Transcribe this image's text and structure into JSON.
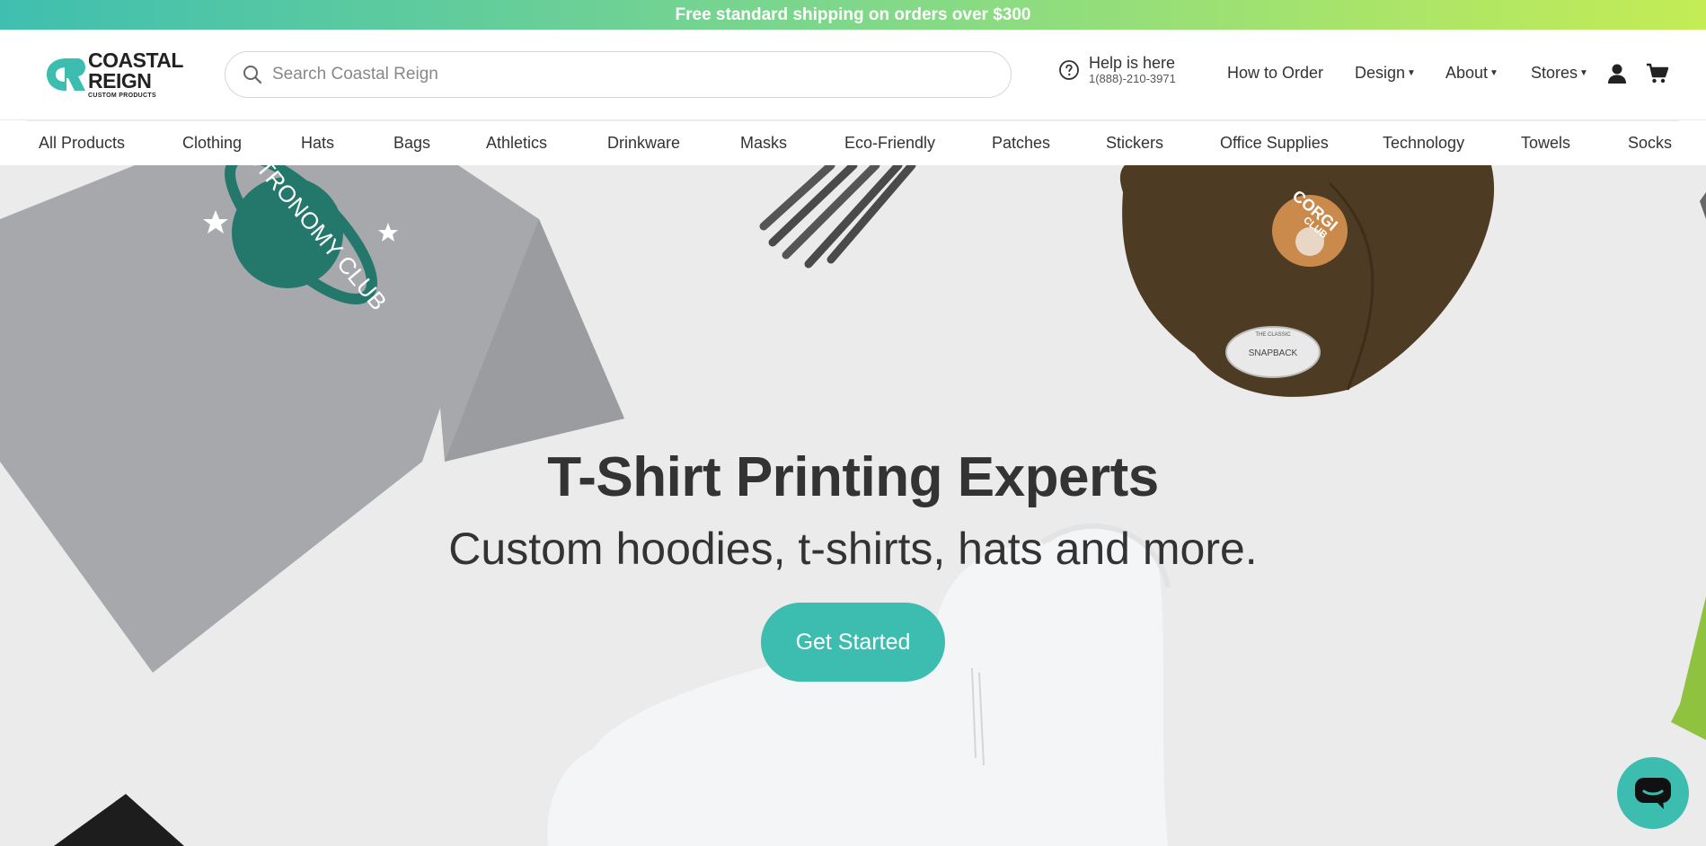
{
  "promo": {
    "text": "Free standard shipping on orders over $300"
  },
  "brand": {
    "line1": "COASTAL",
    "line2": "REIGN",
    "line3": "CUSTOM PRODUCTS"
  },
  "search": {
    "placeholder": "Search Coastal Reign",
    "value": ""
  },
  "help": {
    "title": "Help is here",
    "phone": "1(888)-210-3971"
  },
  "topnav": {
    "how_to_order": "How to Order",
    "design": "Design",
    "about": "About",
    "stores": "Stores"
  },
  "categories": [
    "All Products",
    "Clothing",
    "Hats",
    "Bags",
    "Athletics",
    "Drinkware",
    "Masks",
    "Eco-Friendly",
    "Patches",
    "Stickers",
    "Office Supplies",
    "Technology",
    "Towels",
    "Socks"
  ],
  "hero": {
    "title": "T-Shirt Printing Experts",
    "subtitle": "Custom hoodies, t-shirts, hats and more.",
    "cta": "Get Started",
    "tshirt_print": "ASTRONOMY CLUB",
    "cap_print_top": "CORGI",
    "cap_print_bottom": "CLUB",
    "cap_patch": "SNAPBACK",
    "cap_patch_top": "THE CLASSIC"
  },
  "colors": {
    "accent": "#3dbdb0",
    "text": "#333333",
    "hero_bg": "#ebebeb"
  },
  "icons": [
    "search-icon",
    "help-icon",
    "account-icon",
    "cart-icon",
    "chat-icon",
    "caret-down-icon"
  ]
}
